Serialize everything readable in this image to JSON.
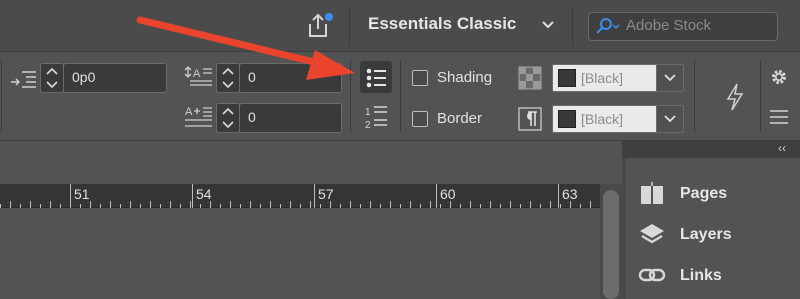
{
  "top_bar": {
    "share_icon": "share-upload-icon",
    "workspace": "Essentials Classic",
    "search_placeholder": "Adobe Stock"
  },
  "control_panel": {
    "indent_value": "0p0",
    "space_before_value": "0",
    "space_after_value": "0",
    "shading_label": "Shading",
    "border_label": "Border",
    "shading_swatch": "[Black]",
    "border_swatch": "[Black]",
    "bulleted_list_icon": "bulleted-list-icon",
    "numbered_list_icon": "numbered-list-icon"
  },
  "ruler": {
    "labels": [
      "51",
      "54",
      "57",
      "60",
      "63"
    ]
  },
  "panels": {
    "collapse": "‹‹",
    "items": [
      {
        "label": "Pages",
        "icon": "pages-icon"
      },
      {
        "label": "Layers",
        "icon": "layers-icon"
      },
      {
        "label": "Links",
        "icon": "links-icon"
      }
    ]
  },
  "colors": {
    "annotation_arrow": "#e8452c",
    "notification_dot": "#3b8df0",
    "search_icon": "#3b8df0"
  }
}
